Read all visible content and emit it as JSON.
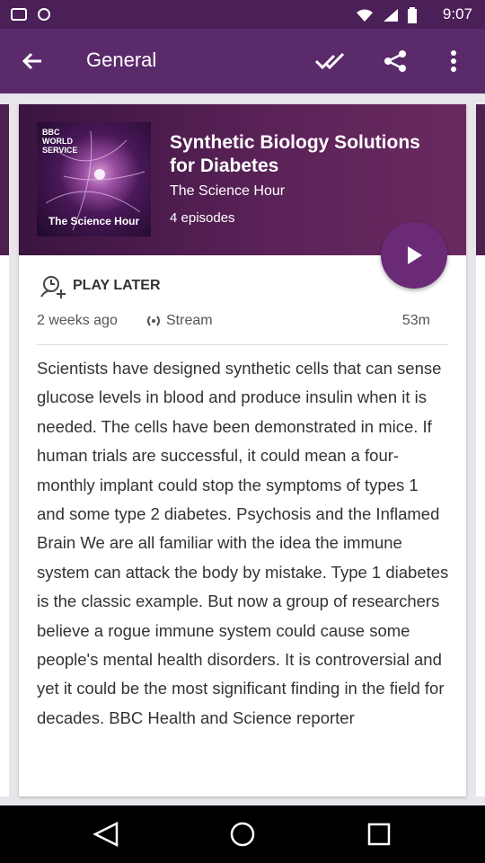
{
  "status_bar": {
    "time": "9:07"
  },
  "app_bar": {
    "title": "General",
    "icons": [
      "back-arrow-icon",
      "check-all-icon",
      "share-icon",
      "more-vert-icon"
    ]
  },
  "episode": {
    "artwork": {
      "brand": "BBC WORLD SERVICE",
      "show_title": "The Science Hour"
    },
    "title": "Synthetic Biology Solutions for Diabetes",
    "show": "The Science Hour",
    "episodes": "4 episodes"
  },
  "actions": {
    "play_later": "PLAY LATER",
    "play_icon": "play-icon"
  },
  "meta": {
    "age": "2 weeks ago",
    "stream": "Stream",
    "duration": "53m"
  },
  "description": "Scientists have designed synthetic cells that can sense glucose levels in blood and produce insulin when it is needed. The cells have been demonstrated in mice. If human trials are successful, it could mean a four-monthly implant could stop the symptoms of types 1 and some type 2 diabetes. Psychosis and the Inflamed Brain We are all familiar with the idea the immune system can attack the body by mistake. Type 1 diabetes is the classic example. But now a group of researchers believe a rogue immune system could cause some people's mental health disorders. It is controversial and yet it could be the most significant finding in the field for decades. BBC Health and Science reporter",
  "colors": {
    "app_bar": "#5b2a6b",
    "status_bar": "#4b1f57",
    "accent_fab": "#6a2a76"
  }
}
